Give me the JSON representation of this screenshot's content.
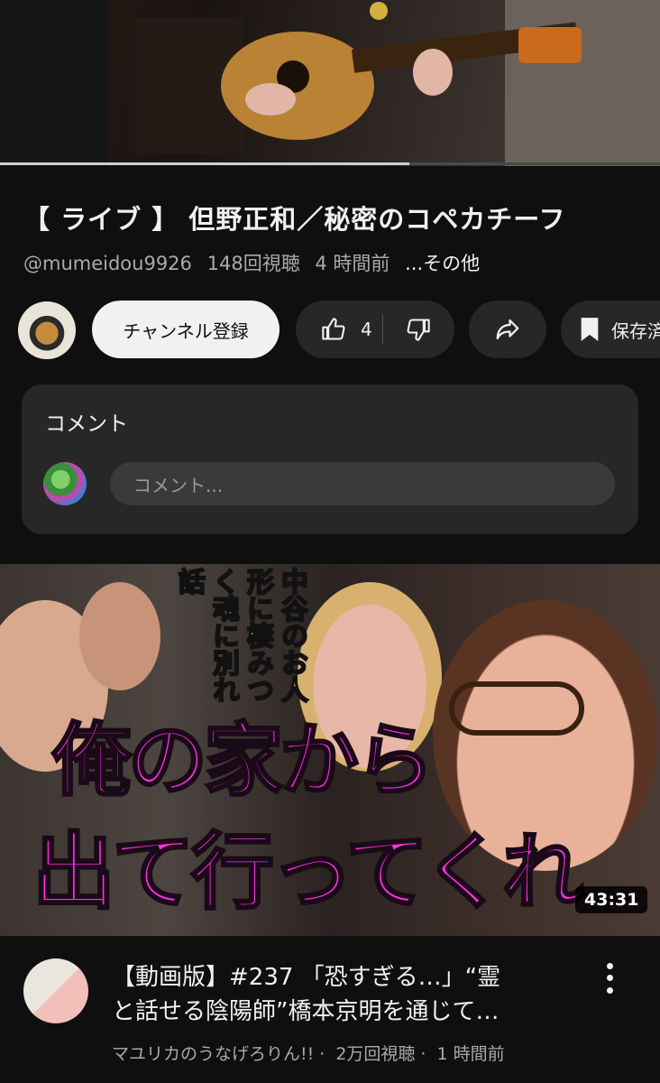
{
  "player": {
    "progress_fraction": 0.62
  },
  "video": {
    "title": "【 ライブ 】 但野正和／秘密のコペカチーフ",
    "channel_handle": "@mumeidou9926",
    "views": "148回視聴",
    "time": "4 時間前",
    "more": "...その他"
  },
  "actions": {
    "subscribe": "チャンネル登録",
    "like_count": "4",
    "save": "保存済み"
  },
  "comments": {
    "title": "コメント",
    "placeholder": "コメント..."
  },
  "next_video": {
    "thumbnail_text": {
      "line1": "俺の家から",
      "line2": "出て行ってくれ",
      "vertical_1": "中谷のお人形に",
      "vertical_2": "棲みつく魂に",
      "vertical_3": "別れ話"
    },
    "duration": "43:31",
    "title_line1": "【動画版】#237 「恐すぎる…」“霊",
    "title_line2": "と話せる陰陽師”橋本京明を通じて…",
    "channel": "マユリカのうなげろりん!!",
    "views": "2万回視聴",
    "time": "1 時間前"
  },
  "icons": {
    "like": "thumbs-up-icon",
    "dislike": "thumbs-down-icon",
    "share": "share-icon",
    "save": "bookmark-icon",
    "menu": "more-vertical-icon"
  },
  "colors": {
    "background": "#0f0f0f",
    "surface": "#272727",
    "thumbnail_text": "#ff2fe1"
  }
}
